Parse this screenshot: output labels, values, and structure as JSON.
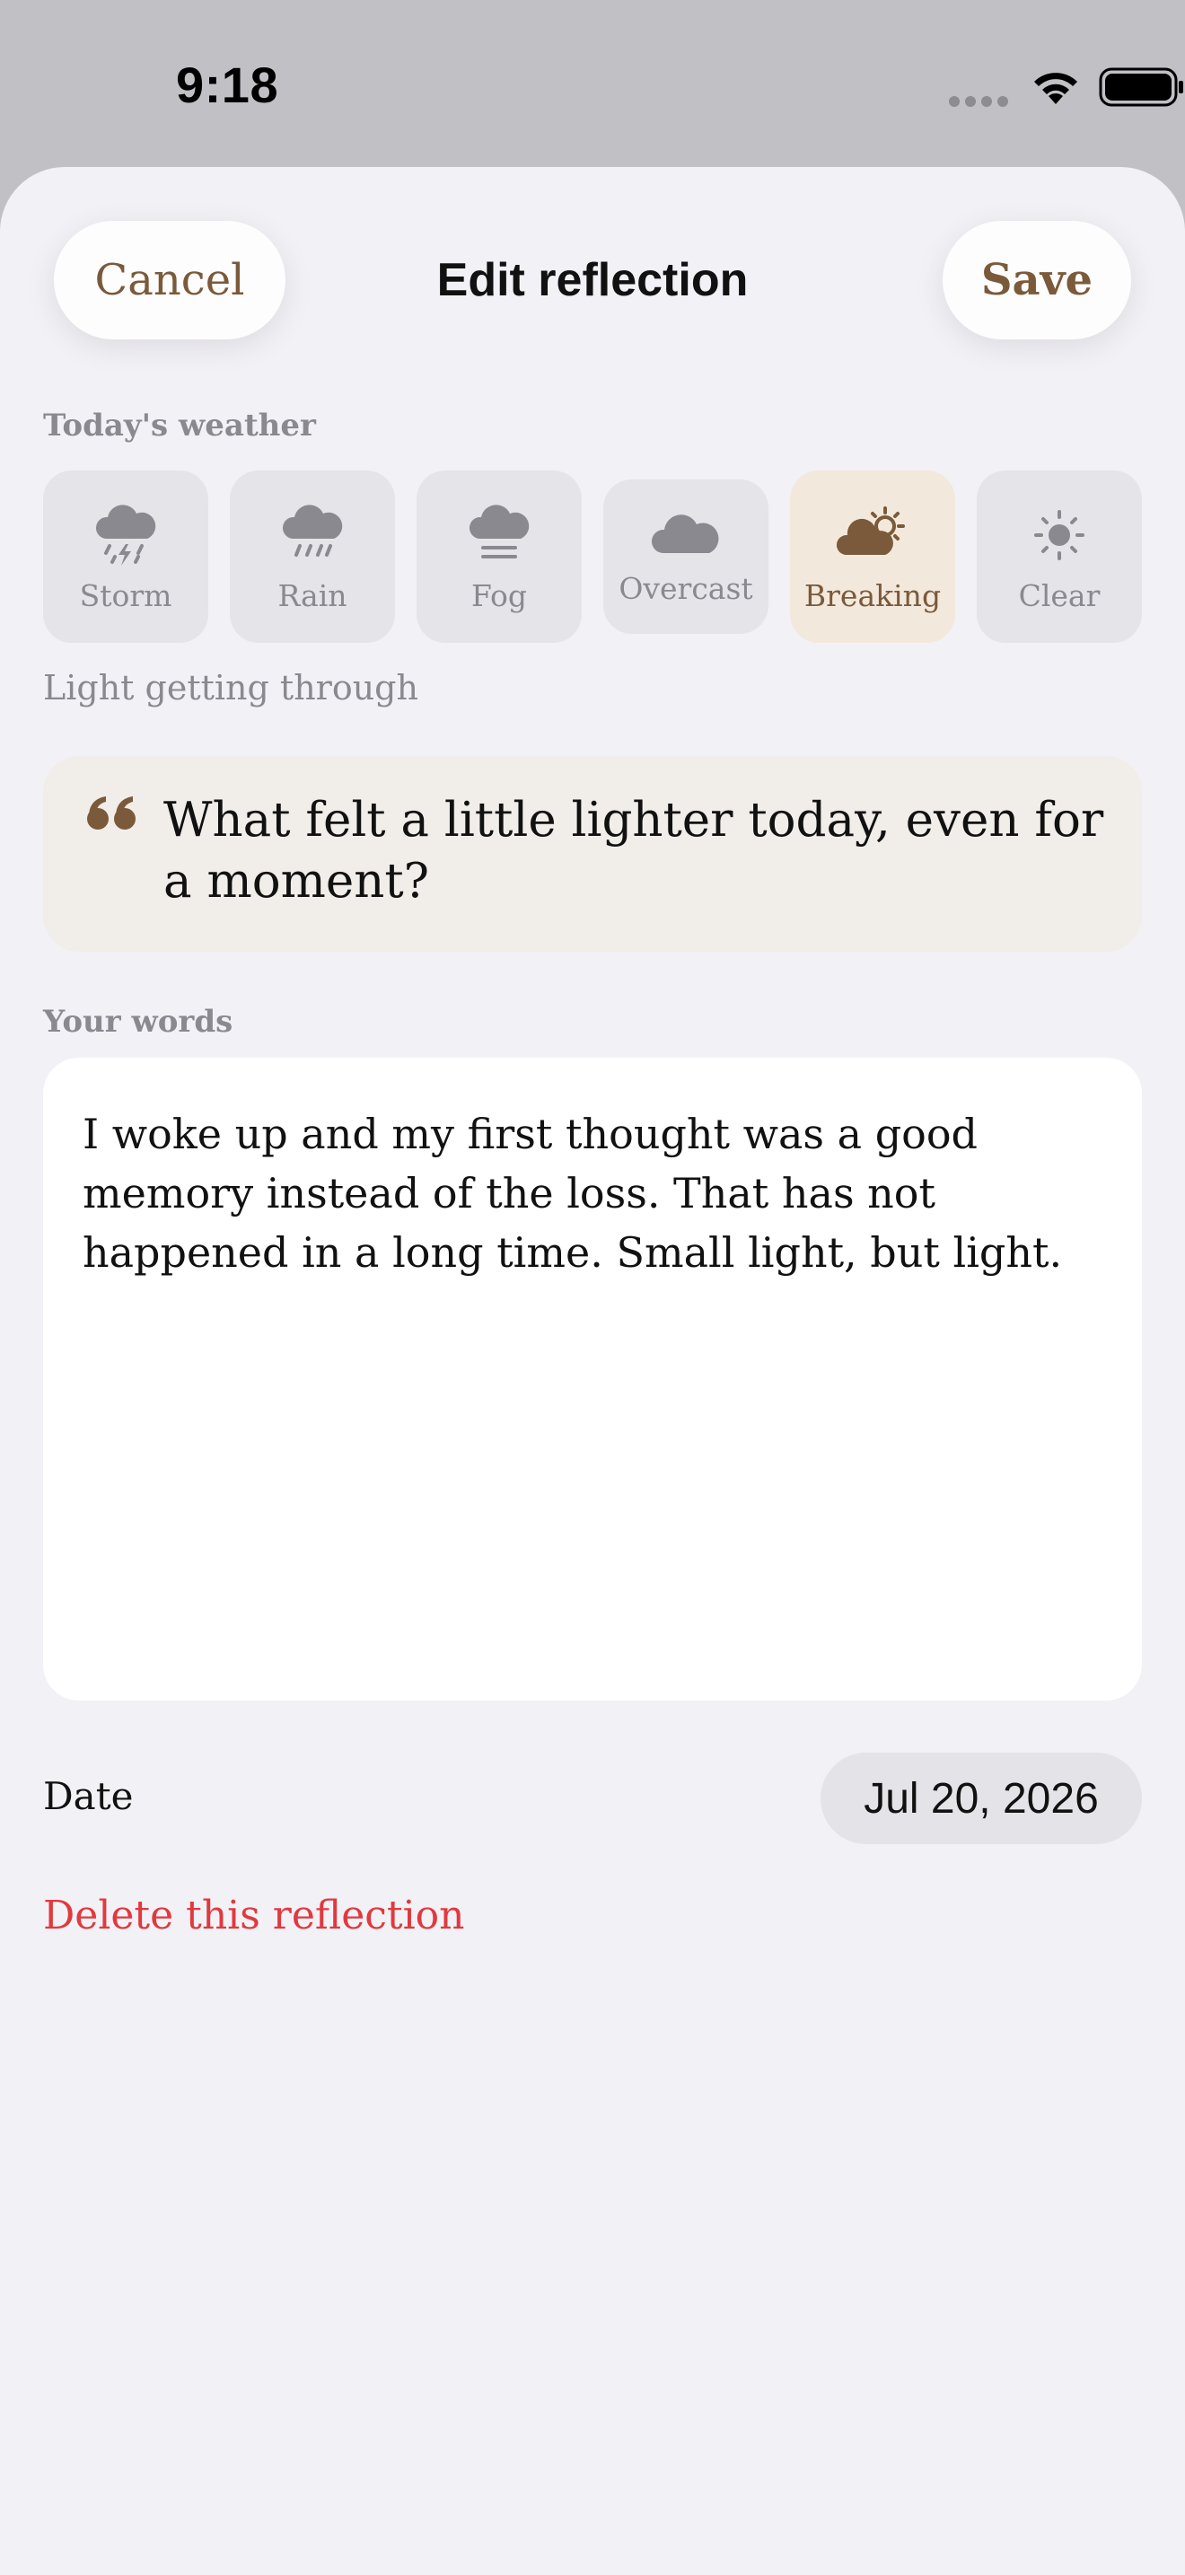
{
  "status": {
    "time": "9:18"
  },
  "header": {
    "cancel_label": "Cancel",
    "title": "Edit reflection",
    "save_label": "Save"
  },
  "weather": {
    "section_label": "Today's weather",
    "options": [
      {
        "label": "Storm",
        "icon": "storm-icon",
        "selected": false
      },
      {
        "label": "Rain",
        "icon": "rain-icon",
        "selected": false
      },
      {
        "label": "Fog",
        "icon": "fog-icon",
        "selected": false
      },
      {
        "label": "Overcast",
        "icon": "overcast-icon",
        "selected": false
      },
      {
        "label": "Breaking",
        "icon": "breaking-icon",
        "selected": true
      },
      {
        "label": "Clear",
        "icon": "sun-icon",
        "selected": false
      }
    ],
    "caption": "Light getting through"
  },
  "prompt": {
    "icon": "quote-icon",
    "text": "What felt a little lighter today, even for a moment?"
  },
  "entry": {
    "section_label": "Your words",
    "text": "I woke up and my first thought was a good memory instead of the loss. That has not happened in a long time. Small light, but light."
  },
  "date": {
    "label": "Date",
    "value": "Jul 20, 2026"
  },
  "delete_label": "Delete this reflection",
  "colors": {
    "accent": "#7a5a3a",
    "selected_tile": "#f3e8dc",
    "destructive": "#e0393e",
    "background": "#f2f1f6"
  }
}
